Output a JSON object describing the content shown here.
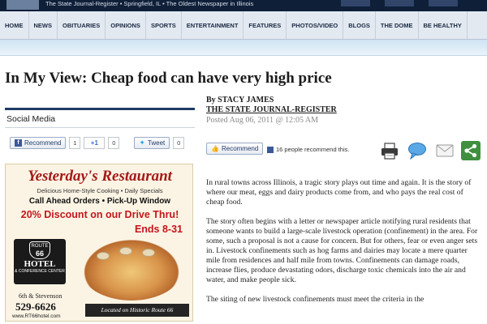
{
  "masthead": {
    "tagline": "The State Journal-Register  •  Springfield, IL  •  The Oldest Newspaper in Illinois"
  },
  "nav": {
    "items": [
      "HOME",
      "NEWS",
      "OBITUARIES",
      "OPINIONS",
      "SPORTS",
      "ENTERTAINMENT",
      "FEATURES",
      "PHOTOS/VIDEO",
      "BLOGS",
      "THE DOME",
      "BE HEALTHY"
    ]
  },
  "article": {
    "headline": "In My View: Cheap food can have very high price",
    "byline": "By STACY JAMES",
    "publication": "THE STATE JOURNAL-REGISTER",
    "posted": "Posted Aug 06, 2011 @ 12:05 AM",
    "paragraphs": [
      "In rural towns across Illinois, a tragic story plays out time and again.  It is the story of where our meat, eggs and dairy products come from, and who pays the real cost of cheap food.",
      "The story often begins with a letter or newspaper article notifying rural residents that someone wants to build a large-scale livestock operation (confinement) in the area. For some, such a proposal is not a cause for concern. But for others, fear or even anger sets in. Livestock confinements such as hog farms and dairies may locate a mere quarter mile from residences and half mile from towns. Confinements can damage roads, increase flies, produce devastating odors, discharge toxic chemicals into the air and water, and make people sick.",
      "The siting of new livestock confinements must meet the criteria in the"
    ]
  },
  "tools": {
    "recommend_label": "Recommend",
    "recommend_count_text": "16 people recommend this.",
    "icons": [
      "print-icon",
      "comment-icon",
      "email-icon",
      "share-icon"
    ]
  },
  "sidebar": {
    "social_title": "Social Media",
    "facebook": {
      "label": "Recommend",
      "count": "1"
    },
    "gplus": {
      "label": "+1",
      "count": "0"
    },
    "twitter": {
      "label": "Tweet",
      "count": "0"
    }
  },
  "ad": {
    "title": "Yesterday's Restaurant",
    "subtitle": "Delicious Home-Style Cooking  •  Daily Specials",
    "call": "Call Ahead Orders  •  Pick-Up Window",
    "discount": "20% Discount on our Drive Thru!",
    "ends": "Ends 8-31",
    "route_top": "ROUTE",
    "route_num": "66",
    "hotel_name": "HOTEL",
    "hotel_sub": "& CONFERENCE CENTER",
    "address": "6th & Stevenson",
    "phone": "529-6626",
    "website": "www.RT66hotel.com",
    "banner": "Located on Historic Route 66"
  },
  "colors": {
    "nav_bg": "#e3e9f1",
    "rule": "#1d3b63",
    "ad_red": "#c4161c",
    "facebook": "#3b5998"
  }
}
